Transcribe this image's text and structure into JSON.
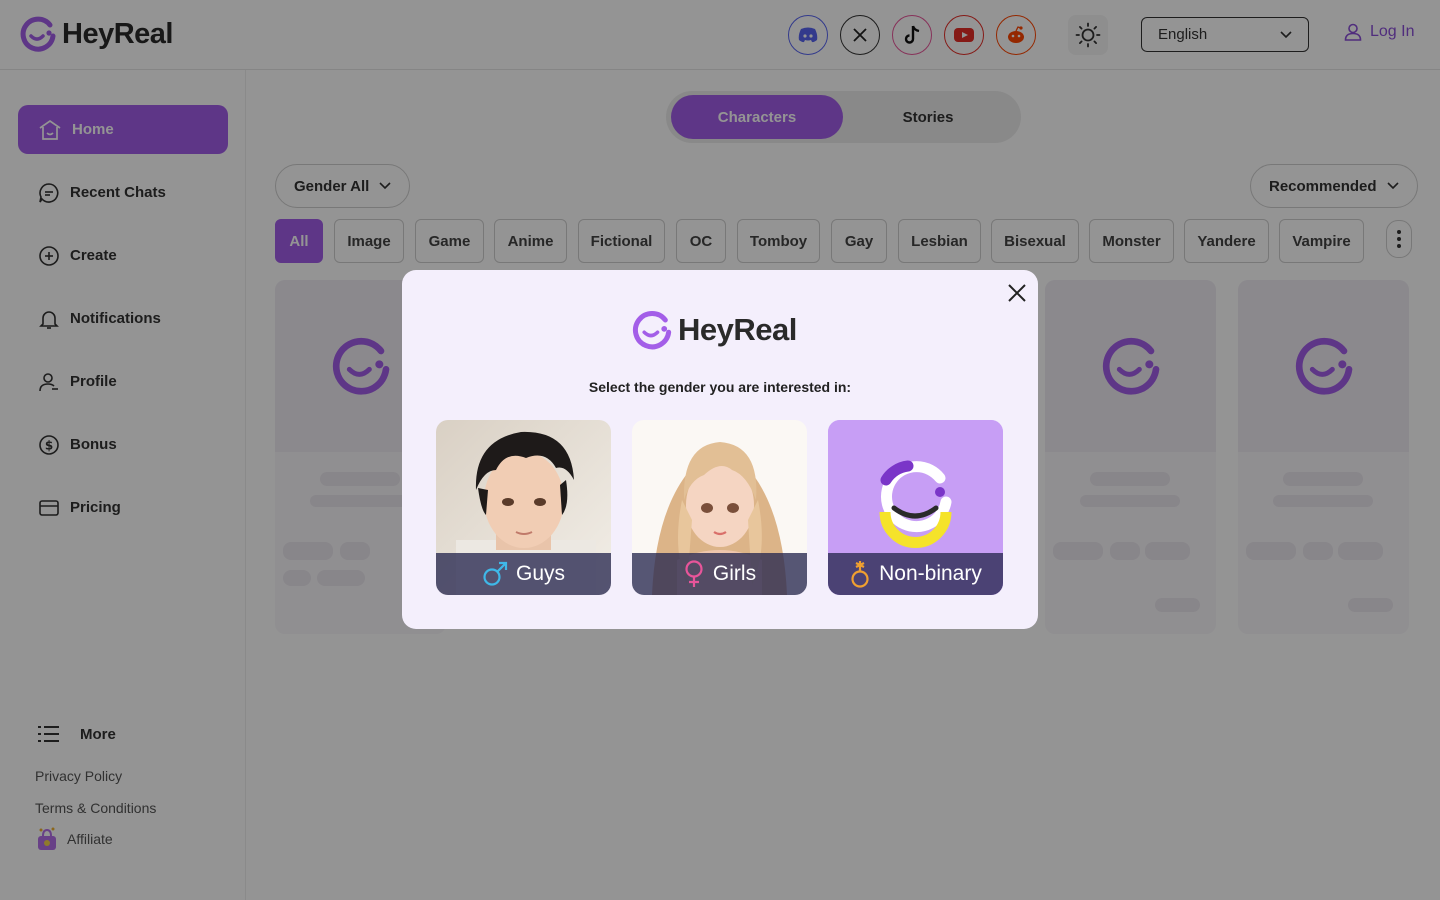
{
  "brand": {
    "name": "HeyReal",
    "accent": "#a35ee8",
    "logo_icon": "heyreal-smile-logo"
  },
  "header": {
    "social": [
      {
        "name": "discord-icon",
        "color": "#5865f2"
      },
      {
        "name": "x-icon",
        "color": "#222222"
      },
      {
        "name": "tiktok-icon",
        "color": "#111111"
      },
      {
        "name": "youtube-icon",
        "color": "#e52d27"
      },
      {
        "name": "reddit-icon",
        "color": "#ff4500"
      }
    ],
    "language": "English",
    "login_label": "Log In"
  },
  "sidebar": {
    "items": [
      {
        "label": "Home",
        "icon": "home-icon"
      },
      {
        "label": "Recent Chats",
        "icon": "chat-icon"
      },
      {
        "label": "Create",
        "icon": "plus-circle-icon"
      },
      {
        "label": "Notifications",
        "icon": "bell-icon"
      },
      {
        "label": "Profile",
        "icon": "user-icon"
      },
      {
        "label": "Bonus",
        "icon": "dollar-icon"
      },
      {
        "label": "Pricing",
        "icon": "wallet-icon"
      }
    ],
    "more_label": "More",
    "privacy": "Privacy Policy",
    "terms": "Terms & Conditions",
    "affiliate": "Affiliate"
  },
  "main": {
    "tabs": [
      "Characters",
      "Stories"
    ],
    "gender_filter": "Gender All",
    "sort": "Recommended",
    "chips": [
      "All",
      "Image",
      "Game",
      "Anime",
      "Fictional",
      "OC",
      "Tomboy",
      "Gay",
      "Lesbian",
      "Bisexual",
      "Monster",
      "Yandere",
      "Vampire"
    ]
  },
  "modal": {
    "logo_text": "HeyReal",
    "prompt": "Select the gender you are interested in:",
    "options": [
      {
        "label": "Guys",
        "icon": "male-symbol-icon",
        "color": "#3fb8e8"
      },
      {
        "label": "Girls",
        "icon": "female-symbol-icon",
        "color": "#e8559a"
      },
      {
        "label": "Non-binary",
        "icon": "nonbinary-symbol-icon",
        "color": "#f0a030"
      }
    ]
  }
}
